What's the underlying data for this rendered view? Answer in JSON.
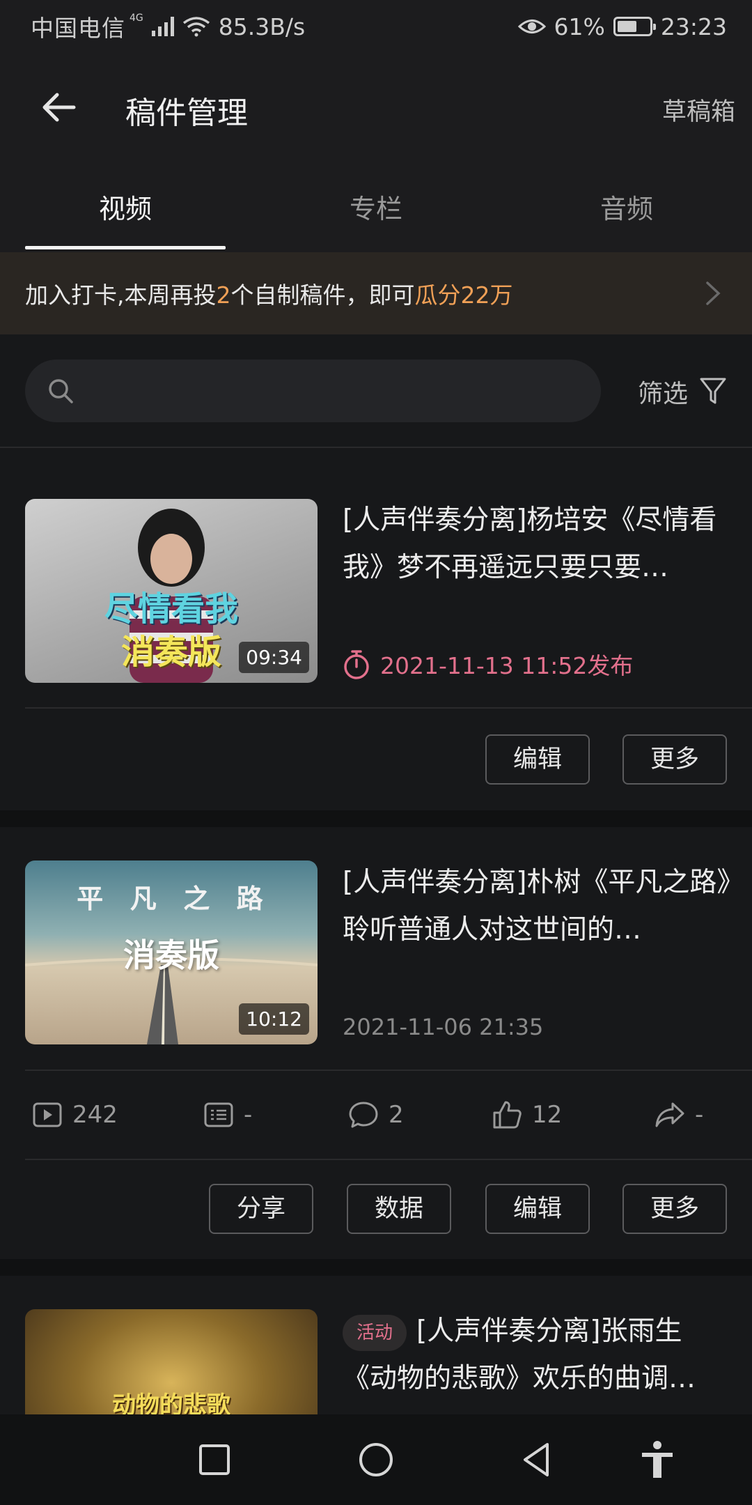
{
  "status_bar": {
    "carrier": "中国电信",
    "network": "4G",
    "speed": "85.3B/s",
    "battery_percent": "61%",
    "battery_level": 0.61,
    "time": "23:23"
  },
  "header": {
    "title": "稿件管理",
    "drafts_label": "草稿箱"
  },
  "tabs": [
    {
      "label": "视频",
      "active": true
    },
    {
      "label": "专栏",
      "active": false
    },
    {
      "label": "音频",
      "active": false
    }
  ],
  "banner": {
    "text_1": "加入打卡,本周再投",
    "count": "2",
    "text_2": "个自制稿件，即可",
    "reward": "瓜分22万"
  },
  "search": {
    "placeholder": "",
    "filter_label": "筛选"
  },
  "videos": [
    {
      "title": "[人声伴奏分离]杨培安《尽情看我》梦不再遥远只要只要…",
      "duration": "09:34",
      "thumb_text_1": "尽情看我",
      "thumb_text_2": "消奏版",
      "publish_time": "2021-11-13 11:52发布",
      "buttons": [
        "编辑",
        "更多"
      ]
    },
    {
      "title": "[人声伴奏分离]朴树《平凡之路》聆听普通人对这世间的…",
      "duration": "10:12",
      "thumb_text_1": "平  凡  之  路",
      "thumb_text_2": "消奏版",
      "date": "2021-11-06 21:35",
      "stats": {
        "plays": "242",
        "danmaku": "-",
        "comments": "2",
        "likes": "12",
        "shares": "-"
      },
      "buttons": [
        "分享",
        "数据",
        "编辑",
        "更多"
      ]
    },
    {
      "tag": "活动",
      "title": "[人声伴奏分离]张雨生《动物的悲歌》欢乐的曲调…",
      "thumb_text_1": "动物的悲歌"
    }
  ],
  "icons": {
    "back": "arrow-left-icon",
    "search": "search-icon",
    "filter": "funnel-icon",
    "timer": "stopwatch-icon"
  },
  "colors": {
    "accent_pink": "#e2708c",
    "banner_highlight": "#f0a056"
  }
}
